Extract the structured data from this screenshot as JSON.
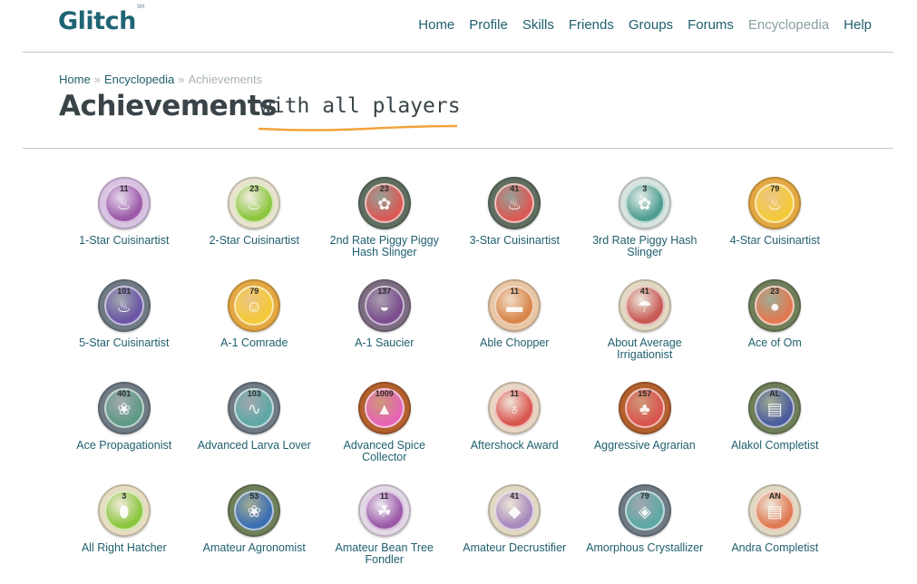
{
  "header": {
    "logo": "Glitch",
    "logo_mark": "SM",
    "nav": [
      "Home",
      "Profile",
      "Skills",
      "Friends",
      "Groups",
      "Forums",
      "Encyclopedia",
      "Help"
    ],
    "active_nav": "Encyclopedia"
  },
  "breadcrumb": {
    "home": "Home",
    "section": "Encyclopedia",
    "current": "Achievements",
    "separator": "»"
  },
  "page": {
    "title": "Achievements",
    "subtitle": "with all players",
    "underline_color": "#f2a33a"
  },
  "achievements": [
    {
      "name": "1-Star Cuisinartist",
      "count": "11",
      "rim": "#d9c3e3",
      "inner": "#9b5aa8",
      "icon": "pot-icon"
    },
    {
      "name": "2-Star Cuisinartist",
      "count": "23",
      "rim": "#e9e3cf",
      "inner": "#8dc640",
      "icon": "pot-icon"
    },
    {
      "name": "2nd Rate Piggy Piggy Hash Slinger",
      "count": "23",
      "rim": "#5f6e60",
      "inner": "#d95a56",
      "icon": "pig-icon"
    },
    {
      "name": "3-Star Cuisinartist",
      "count": "41",
      "rim": "#5f6e60",
      "inner": "#d95a56",
      "icon": "pot-icon"
    },
    {
      "name": "3rd Rate Piggy Hash Slinger",
      "count": "3",
      "rim": "#d8e3de",
      "inner": "#4f9e91",
      "icon": "pig-icon"
    },
    {
      "name": "4-Star Cuisinartist",
      "count": "79",
      "rim": "#e3a843",
      "inner": "#f3c93a",
      "icon": "pot-icon"
    },
    {
      "name": "5-Star Cuisinartist",
      "count": "101",
      "rim": "#6f7a84",
      "inner": "#6b55a6",
      "icon": "pot-icon"
    },
    {
      "name": "A-1 Comrade",
      "count": "79",
      "rim": "#e3a843",
      "inner": "#f3c93a",
      "icon": "creature-icon"
    },
    {
      "name": "A-1 Saucier",
      "count": "137",
      "rim": "#7c6d83",
      "inner": "#7b4e8e",
      "icon": "saucepan-icon"
    },
    {
      "name": "Able Chopper",
      "count": "11",
      "rim": "#e8c7a6",
      "inner": "#d9864a",
      "icon": "cutting-board-icon"
    },
    {
      "name": "About Average Irrigationist",
      "count": "41",
      "rim": "#e2d9c3",
      "inner": "#c75a55",
      "icon": "watering-can-icon"
    },
    {
      "name": "Ace of Om",
      "count": "23",
      "rim": "#6f7f5a",
      "inner": "#e07a53",
      "icon": "orb-icon"
    },
    {
      "name": "Ace Propagationist",
      "count": "401",
      "rim": "#6f7a84",
      "inner": "#5f9a86",
      "icon": "corn-icon"
    },
    {
      "name": "Advanced Larva Lover",
      "count": "103",
      "rim": "#6f7a84",
      "inner": "#5fa8a6",
      "icon": "larva-icon"
    },
    {
      "name": "Advanced Spice Collector",
      "count": "1009",
      "rim": "#b3602f",
      "inner": "#e565b3",
      "icon": "spice-icon"
    },
    {
      "name": "Aftershock Award",
      "count": "11",
      "rim": "#e8d6c3",
      "inner": "#d9564f",
      "icon": "glass-icon"
    },
    {
      "name": "Aggressive Agrarian",
      "count": "157",
      "rim": "#b3602f",
      "inner": "#d9564f",
      "icon": "tree-icon"
    },
    {
      "name": "Alakol Completist",
      "count": "AL",
      "rim": "#6f7f5a",
      "inner": "#4c5d9e",
      "icon": "map-icon"
    },
    {
      "name": "All Right Hatcher",
      "count": "3",
      "rim": "#e8dcc3",
      "inner": "#8dc640",
      "icon": "egg-icon"
    },
    {
      "name": "Amateur Agronomist",
      "count": "53",
      "rim": "#6f7f5a",
      "inner": "#3d6fb3",
      "icon": "corn-icon"
    },
    {
      "name": "Amateur Bean Tree Fondler",
      "count": "11",
      "rim": "#e3d9e6",
      "inner": "#9b5aa8",
      "icon": "bean-icon"
    },
    {
      "name": "Amateur Decrustifier",
      "count": "41",
      "rim": "#e2d9c3",
      "inner": "#a889bd",
      "icon": "rock-icon"
    },
    {
      "name": "Amorphous Crystallizer",
      "count": "79",
      "rim": "#6f7a84",
      "inner": "#5fa8a6",
      "icon": "crystal-icon"
    },
    {
      "name": "Andra Completist",
      "count": "AN",
      "rim": "#e2d9c3",
      "inner": "#e07a53",
      "icon": "map-icon"
    }
  ]
}
